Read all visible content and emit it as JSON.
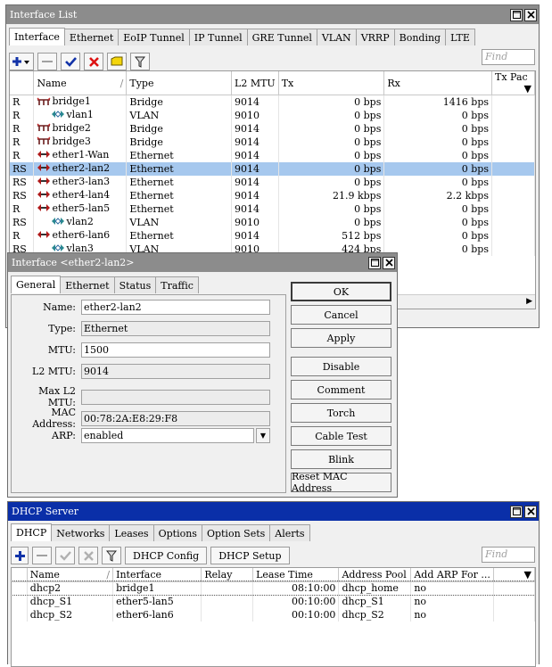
{
  "iface_window": {
    "title": "Interface List",
    "tabs": [
      "Interface",
      "Ethernet",
      "EoIP Tunnel",
      "IP Tunnel",
      "GRE Tunnel",
      "VLAN",
      "VRRP",
      "Bonding",
      "LTE"
    ],
    "find_placeholder": "Find",
    "columns": [
      "",
      "Name",
      "Type",
      "L2 MTU",
      "Tx",
      "Rx",
      "Tx Pac"
    ],
    "rows": [
      {
        "flag": "R",
        "name": "bridge1",
        "icon": "bridge-icon",
        "indent": 0,
        "type": "Bridge",
        "l2mtu": "9014",
        "tx": "0 bps",
        "rx": "1416 bps"
      },
      {
        "flag": "R",
        "name": "vlan1",
        "icon": "vlan-icon",
        "indent": 1,
        "type": "VLAN",
        "l2mtu": "9010",
        "tx": "0 bps",
        "rx": "0 bps"
      },
      {
        "flag": "R",
        "name": "bridge2",
        "icon": "bridge-icon",
        "indent": 0,
        "type": "Bridge",
        "l2mtu": "9014",
        "tx": "0 bps",
        "rx": "0 bps"
      },
      {
        "flag": "R",
        "name": "bridge3",
        "icon": "bridge-icon",
        "indent": 0,
        "type": "Bridge",
        "l2mtu": "9014",
        "tx": "0 bps",
        "rx": "0 bps"
      },
      {
        "flag": "R",
        "name": "ether1-Wan",
        "icon": "ethernet-icon",
        "indent": 0,
        "type": "Ethernet",
        "l2mtu": "9014",
        "tx": "0 bps",
        "rx": "0 bps"
      },
      {
        "flag": "RS",
        "name": "ether2-lan2",
        "icon": "ethernet-icon",
        "indent": 0,
        "type": "Ethernet",
        "l2mtu": "9014",
        "tx": "0 bps",
        "rx": "0 bps",
        "selected": true
      },
      {
        "flag": "RS",
        "name": "ether3-lan3",
        "icon": "ethernet-icon",
        "indent": 0,
        "type": "Ethernet",
        "l2mtu": "9014",
        "tx": "0 bps",
        "rx": "0 bps"
      },
      {
        "flag": "RS",
        "name": "ether4-lan4",
        "icon": "ethernet-icon",
        "indent": 0,
        "type": "Ethernet",
        "l2mtu": "9014",
        "tx": "21.9 kbps",
        "rx": "2.2 kbps"
      },
      {
        "flag": "R",
        "name": "ether5-lan5",
        "icon": "ethernet-icon",
        "indent": 0,
        "type": "Ethernet",
        "l2mtu": "9014",
        "tx": "0 bps",
        "rx": "0 bps"
      },
      {
        "flag": "RS",
        "name": "vlan2",
        "icon": "vlan-icon",
        "indent": 1,
        "type": "VLAN",
        "l2mtu": "9010",
        "tx": "0 bps",
        "rx": "0 bps"
      },
      {
        "flag": "R",
        "name": "ether6-lan6",
        "icon": "ethernet-icon",
        "indent": 0,
        "type": "Ethernet",
        "l2mtu": "9014",
        "tx": "512 bps",
        "rx": "0 bps"
      },
      {
        "flag": "RS",
        "name": "vlan3",
        "icon": "vlan-icon",
        "indent": 1,
        "type": "VLAN",
        "l2mtu": "9010",
        "tx": "424 bps",
        "rx": "0 bps"
      }
    ]
  },
  "edit_window": {
    "title": "Interface <ether2-lan2>",
    "tabs": [
      "General",
      "Ethernet",
      "Status",
      "Traffic"
    ],
    "fields": {
      "name_label": "Name:",
      "name_value": "ether2-lan2",
      "type_label": "Type:",
      "type_value": "Ethernet",
      "mtu_label": "MTU:",
      "mtu_value": "1500",
      "l2mtu_label": "L2 MTU:",
      "l2mtu_value": "9014",
      "maxl2mtu_label": "Max L2 MTU:",
      "maxl2mtu_value": "",
      "mac_label": "MAC Address:",
      "mac_value": "00:78:2A:E8:29:F8",
      "arp_label": "ARP:",
      "arp_value": "enabled"
    },
    "buttons": {
      "ok": "OK",
      "cancel": "Cancel",
      "apply": "Apply",
      "disable": "Disable",
      "comment": "Comment",
      "torch": "Torch",
      "cable_test": "Cable Test",
      "blink": "Blink",
      "reset_mac": "Reset MAC Address"
    }
  },
  "dhcp_window": {
    "title": "DHCP Server",
    "tabs": [
      "DHCP",
      "Networks",
      "Leases",
      "Options",
      "Option Sets",
      "Alerts"
    ],
    "config_label": "DHCP Config",
    "setup_label": "DHCP Setup",
    "find_placeholder": "Find",
    "columns": [
      "Name",
      "Interface",
      "Relay",
      "Lease Time",
      "Address Pool",
      "Add ARP For ..."
    ],
    "rows": [
      {
        "name": "dhcp2",
        "interface": "bridge1",
        "relay": "",
        "lease": "08:10:00",
        "pool": "dhcp_home",
        "arp": "no"
      },
      {
        "name": "dhcp_S1",
        "interface": "ether5-lan5",
        "relay": "",
        "lease": "00:10:00",
        "pool": "dhcp_S1",
        "arp": "no"
      },
      {
        "name": "dhcp_S2",
        "interface": "ether6-lan6",
        "relay": "",
        "lease": "00:10:00",
        "pool": "dhcp_S2",
        "arp": "no"
      }
    ]
  },
  "colors": {
    "active_title": "#0a2fa8",
    "inactive_title": "#8c8c8c",
    "selection": "#a6c8ee"
  }
}
